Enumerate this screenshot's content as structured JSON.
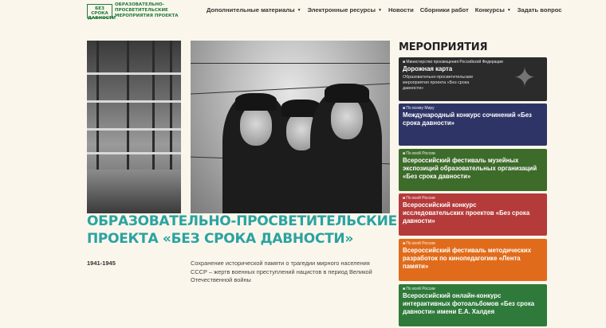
{
  "header": {
    "logo_box_lines": [
      "БЕЗ СРОКА",
      "ДАВНОСТИ"
    ],
    "logo_text_lines": [
      "ОБРАЗОВАТЕЛЬНО-ПРОСВЕТИТЕЛЬСКИЕ",
      "МЕРОПРИЯТИЯ ПРОЕКТА"
    ],
    "nav": [
      {
        "label": "Дополнительные материалы",
        "dropdown": true
      },
      {
        "label": "Электронные ресурсы",
        "dropdown": true
      },
      {
        "label": "Новости",
        "dropdown": false
      },
      {
        "label": "Сборники работ",
        "dropdown": false
      },
      {
        "label": "Конкурсы",
        "dropdown": true
      },
      {
        "label": "Задать вопрос",
        "dropdown": false
      }
    ]
  },
  "hero": {
    "title_lines": [
      "ОБРАЗОВАТЕЛЬНО-ПРОСВЕТИТЕЛЬСКИЕ МЕРОПРИЯТИЯ",
      "ПРОЕКТА «БЕЗ СРОКА ДАВНОСТИ»"
    ],
    "years": "1941-1945",
    "description_lines": [
      "Сохранение исторической памяти о трагедии мирного населения",
      "СССР – жертв военных преступлений нацистов в период Великой",
      "Отечественной войны"
    ]
  },
  "events": {
    "heading": "МЕРОПРИЯТИЯ",
    "cards": [
      {
        "tag": "■ Министерство просвещения Российской Федерации",
        "title_lines": [
          "Дорожная карта"
        ],
        "sub_lines": [
          "Образовательно-просветительские",
          "мероприятия проекта «Без срока",
          "давности»"
        ],
        "color": "#2b2b2b",
        "icon": "coat-of-arms"
      },
      {
        "tag": "■ По всему Миру",
        "title_lines": [
          "Международный конкурс сочинений «Без",
          "срока давности»"
        ],
        "color": "#2e3566"
      },
      {
        "tag": "■ По всей России",
        "title_lines": [
          "Всероссийский фестиваль музейных",
          "экспозиций образовательных организаций",
          "«Без срока давности»"
        ],
        "color": "#3d6b2a"
      },
      {
        "tag": "■ По всей России",
        "title_lines": [
          "Всероссийский конкурс",
          "исследовательских проектов «Без срока",
          "давности»"
        ],
        "color": "#b53a3a"
      },
      {
        "tag": "■ По всей России",
        "title_lines": [
          "Всероссийский фестиваль методических",
          "разработок по кинопедагогике «Лента",
          "памяти»"
        ],
        "color": "#e06c1b"
      },
      {
        "tag": "■ По всей России",
        "title_lines": [
          "Всероссийский онлайн-конкурс",
          "интерактивных фотоальбомов «Без срока",
          "давности» имени Е.А. Халдея"
        ],
        "color": "#2f7a3a"
      }
    ]
  }
}
